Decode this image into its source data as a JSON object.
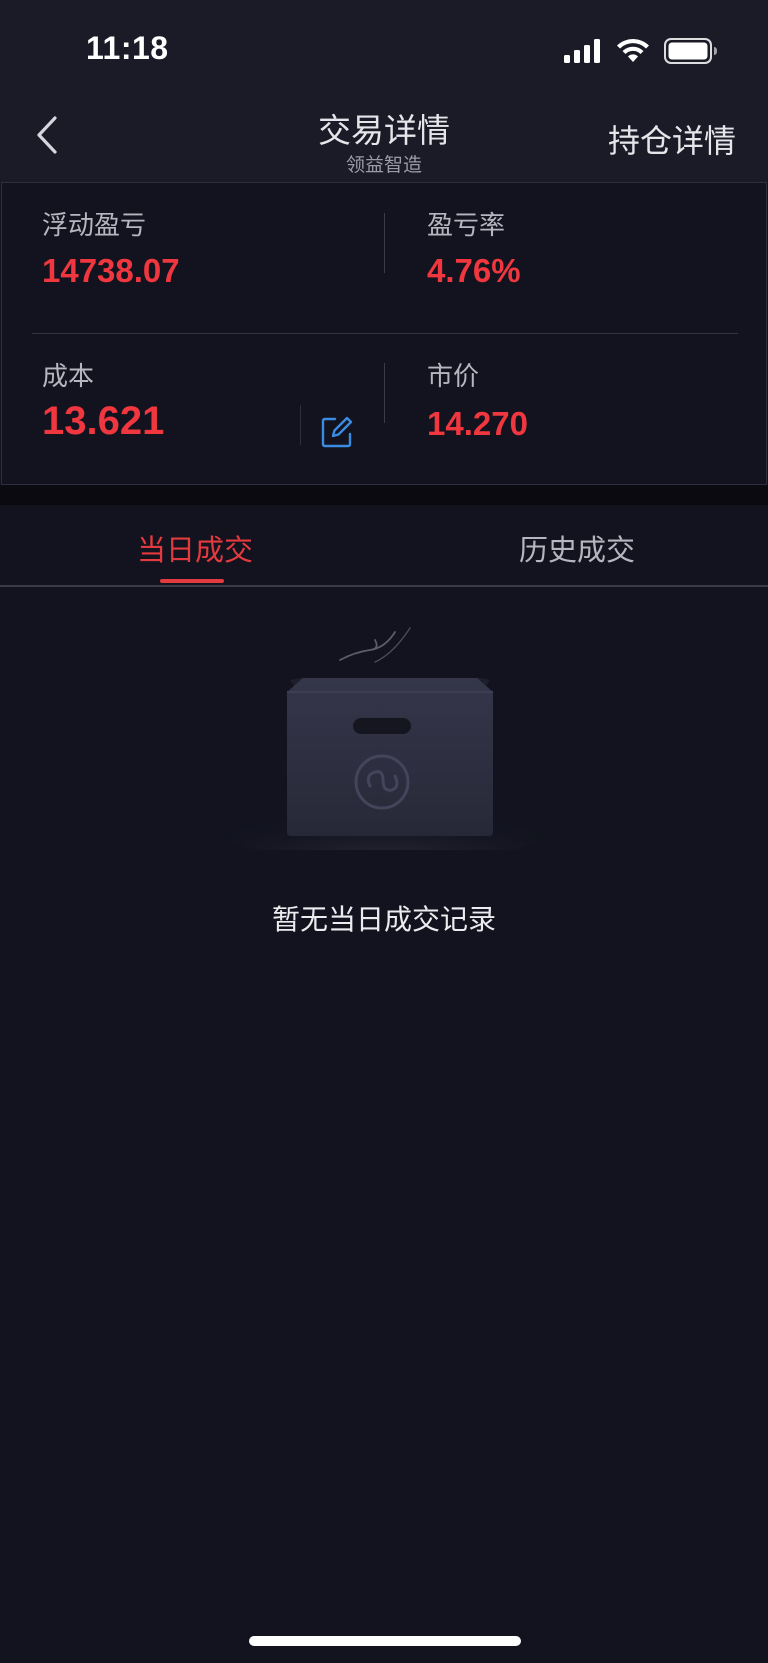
{
  "status_bar": {
    "time": "11:18",
    "icons": [
      "cellular-signal-icon",
      "wifi-icon",
      "battery-icon"
    ]
  },
  "nav": {
    "title": "交易详情",
    "subtitle": "领益智造",
    "right_action": "持仓详情",
    "back_icon": "chevron-left-icon"
  },
  "summary": {
    "floating_pl_label": "浮动盈亏",
    "floating_pl_value": "14738.07",
    "pl_rate_label": "盈亏率",
    "pl_rate_value": "4.76%",
    "cost_label": "成本",
    "cost_value": "13.621",
    "market_price_label": "市价",
    "market_price_value": "14.270",
    "edit_icon": "edit-icon"
  },
  "tabs": [
    {
      "label": "当日成交",
      "active": true
    },
    {
      "label": "历史成交",
      "active": false
    }
  ],
  "empty_state": {
    "message": "暂无当日成交记录",
    "icon": "empty-box-icon"
  },
  "colors": {
    "background": "#12131e",
    "header": "#1a1b27",
    "accent_red": "#f0373f",
    "edit_blue": "#3b8be0"
  }
}
